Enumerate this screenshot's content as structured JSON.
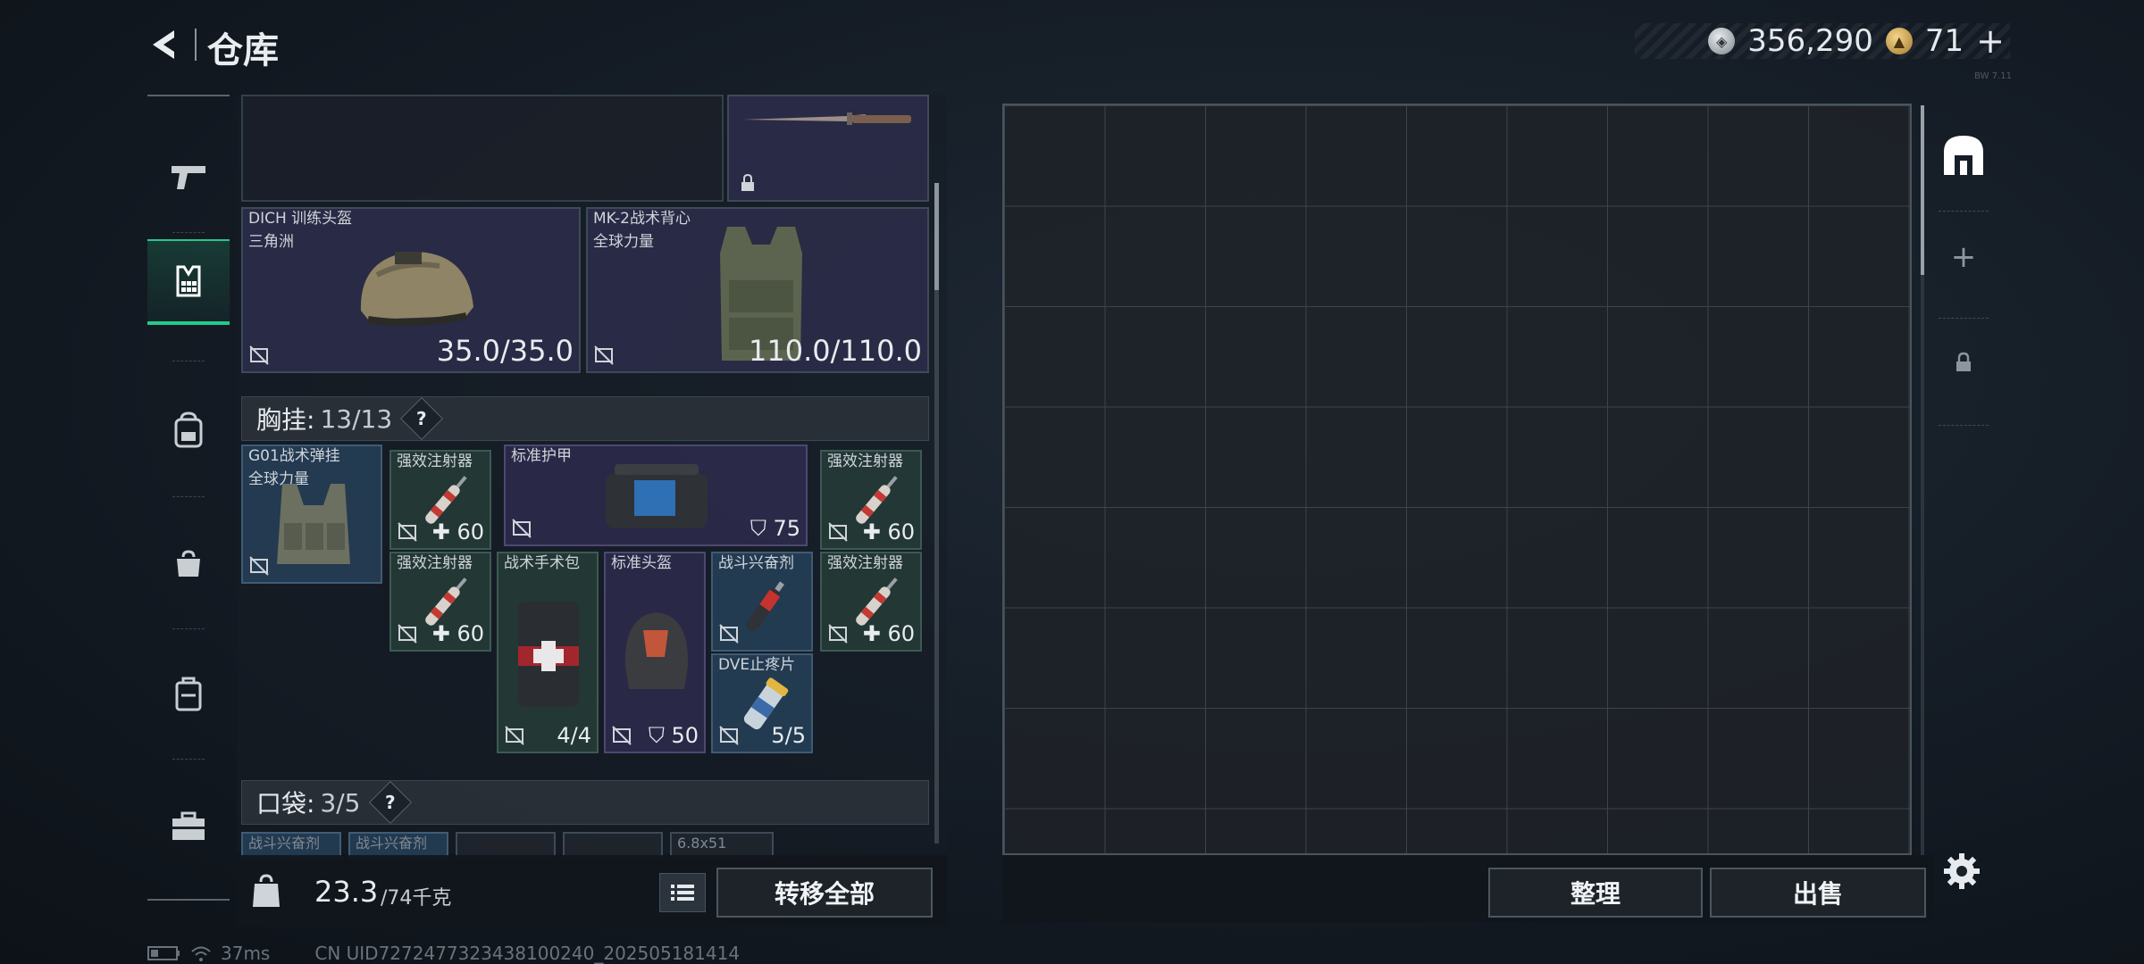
{
  "header": {
    "title": "仓库",
    "currency_silver": "356,290",
    "currency_gold": "71",
    "plus_label": "+",
    "version": "BW 7.11"
  },
  "icons": {
    "back": "back-arrow-icon",
    "silver": "silver-coin-icon",
    "gold": "gold-coin-icon",
    "rail": [
      "pistol-icon",
      "vest-icon",
      "backpack-icon",
      "bag-icon",
      "case-icon",
      "toolbox-icon"
    ],
    "right_rail": [
      "storage-icon",
      "add-icon",
      "lock-icon"
    ]
  },
  "equipped": {
    "helmet": {
      "name": "DICH 训练头盔",
      "brand": "三角洲",
      "durability": "35.0/35.0"
    },
    "armor": {
      "name": "MK-2战术背心",
      "brand": "全球力量",
      "durability": "110.0/110.0"
    }
  },
  "chest_rig": {
    "label": "胸挂:",
    "count": "13/13",
    "help": "?",
    "rig": {
      "name": "G01战术弹挂",
      "brand": "全球力量"
    },
    "items": [
      {
        "name": "强效注射器",
        "value": "60"
      },
      {
        "name": "标准护甲",
        "value": "75"
      },
      {
        "name": "强效注射器",
        "value": "60"
      },
      {
        "name": "强效注射器",
        "value": "60"
      },
      {
        "name": "战术手术包",
        "value": "4/4"
      },
      {
        "name": "标准头盔",
        "value": "50"
      },
      {
        "name": "战斗兴奋剂",
        "value": ""
      },
      {
        "name": "强效注射器",
        "value": "60"
      },
      {
        "name": "DVE止疼片",
        "value": "5/5"
      }
    ]
  },
  "pockets": {
    "label": "口袋:",
    "count": "3/5",
    "help": "?",
    "items": [
      "战斗兴奋剂",
      "战斗兴奋剂",
      "",
      "",
      "6.8x51"
    ]
  },
  "capacity": {
    "current": "23.3",
    "max": "/74千克"
  },
  "buttons": {
    "transfer_all": "转移全部",
    "organize": "整理",
    "sell": "出售"
  },
  "status": {
    "ping": "37ms",
    "uid": "CN UID7272477323438100240_202505181414"
  }
}
